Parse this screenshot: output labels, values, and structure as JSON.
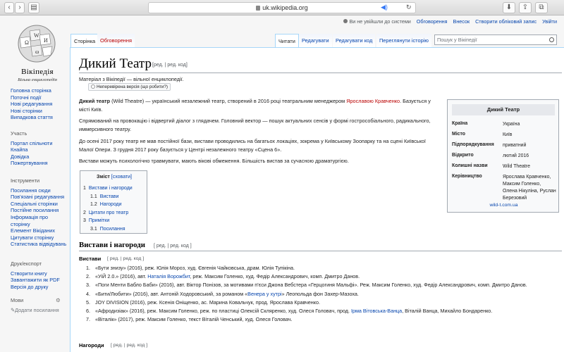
{
  "browser": {
    "url": "uk.wikipedia.org"
  },
  "logo": {
    "name": "Вікіпедія",
    "subtitle": "Вільна енциклопедія"
  },
  "header": {
    "not_logged": "Ви не увійшли до системи",
    "links": [
      "Обговорення",
      "Внесок",
      "Створити обліковий запис",
      "Увійти"
    ]
  },
  "sidebar": {
    "main": [
      "Головна сторінка",
      "Поточні події",
      "Нові редагування",
      "Нові сторінки",
      "Випадкова стаття"
    ],
    "participate_heading": "Участь",
    "participate": [
      "Портал спільноти",
      "Кнайпа",
      "Довідка",
      "Пожертвування"
    ],
    "tools_heading": "Інструменти",
    "tools": [
      "Посилання сюди",
      "Пов'язані редагування",
      "Спеціальні сторінки",
      "Постійне посилання",
      "Інформація про сторінку",
      "Елемент Вікіданих",
      "Цитувати сторінку",
      "Статистика відвідувань"
    ],
    "print_heading": "Друк/експорт",
    "print": [
      "Створити книгу",
      "Завантажити як PDF",
      "Версія до друку"
    ],
    "lang_heading": "Мови",
    "add_links": "Додати посилання"
  },
  "tabs": {
    "left": [
      "Сторінка",
      "Обговорення"
    ],
    "right": [
      "Читати",
      "Редагувати",
      "Редагувати код",
      "Переглянути історію"
    ],
    "search_placeholder": "Пошук у Вікіпедії"
  },
  "article": {
    "title": "Дикий Театр",
    "title_edit": "[ред. | ред. код]",
    "tagline": "Матеріал з Вікіпедії — вільної енциклопедії.",
    "unverified": "Неперевірена версія (що робити?)",
    "p1_bold": "Дикий театр",
    "p1_a": " (Wild Theatre) — український незалежний театр, створений в 2016 році театральним менеджером ",
    "p1_link": "Ярославою Кравченко",
    "p1_b": ". Базується у місті Київ.",
    "p2": "Спрямований на провокацію і відвертий діалог з глядачем. Головний вектор — пошук актуальних сенсів у формі гострособіального, радикального, иммерсивного театру.",
    "p3": "До осені 2017 року театр не мав постійної бази, вистави проводились на багатьох локаціях, зокрема у Київському Зоопарку та на сцені Київської Малої Опери. З грудня 2017 року базується у Центрі незалежного театру «Сцена 6».",
    "p4": "Вистави можуть психологічно травмувати, мають вікові обмеження. Більшість вистав за сучасною драматургією."
  },
  "infobox": {
    "title": "Дикий Театр",
    "rows": [
      {
        "k": "Країна",
        "v": "Україна"
      },
      {
        "k": "Місто",
        "v": "Київ"
      },
      {
        "k": "Підпорядкування",
        "v": "приватний"
      },
      {
        "k": "Відкрито",
        "v": "лютий 2016"
      },
      {
        "k": "Колишні назви",
        "v": "Wild Theatre"
      },
      {
        "k": "Керівництво",
        "v": "Ярослава Кравченко, Максим Голенко, Олена Нікуліна, Руслан Березовий"
      }
    ],
    "link": "wild-t.com.ua"
  },
  "toc": {
    "title": "Зміст",
    "toggle": "[сховати]",
    "items": [
      {
        "n": "1",
        "t": "Вистави і нагороди",
        "sub": false
      },
      {
        "n": "1.1",
        "t": "Вистави",
        "sub": true
      },
      {
        "n": "1.2",
        "t": "Нагороди",
        "sub": true
      },
      {
        "n": "2",
        "t": "Цитати про театр",
        "sub": false
      },
      {
        "n": "3",
        "t": "Примітки",
        "sub": false
      },
      {
        "n": "3.1",
        "t": "Посилання",
        "sub": true
      }
    ]
  },
  "section": {
    "h2": "Вистави і нагороди",
    "h2_edit": "[ ред. | ред. код ]",
    "h3_plays": "Вистави",
    "h3_edit": "[ ред. | ред. код ]",
    "h3_awards": "Нагороди",
    "h3_awards_edit": "[ ред. | ред. код ]",
    "plays": [
      {
        "n": "1.",
        "a": "«Бути знизу» (2016), реж. Юлія Мороз, худ. Євгенія Чайковська, драм. Юлія Тупікіна.",
        "link": "",
        "b": ""
      },
      {
        "n": "2.",
        "a": "«УіЙ 2.0.» (2016), авт. ",
        "link": "Наталія Ворожбит",
        "b": ", реж. Максим Голенко, худ. Федір Александрович, комп. Дмитро Данов."
      },
      {
        "n": "3.",
        "a": "«Поги Менти Бабло Баби» (2016), авт. Віктор Понізов, за мотивами п'єси Джона Вебстера «Герцогиня Мальфі». Реж. Максим Голенко, худ. Федір Александрович, комп. Дмитро Данов.",
        "link": "",
        "b": ""
      },
      {
        "n": "4.",
        "a": "«Бити/Любити» (2016), авт. Антоній Ходоровський, за романом «",
        "link": "Венера у хутрі",
        "b": "» Леопольда фон Захер-Мазоха."
      },
      {
        "n": "5.",
        "a": "JOY DIVISION (2016), реж. Ксенія Оніщенко, ас. Марина Ковальчук, прод. Ярослава Кравченко.",
        "link": "",
        "b": ""
      },
      {
        "n": "6.",
        "a": "«Афродизіак» (2016), реж. Максим Голенко, реж. по пластиці Олексій Скляренко, худ. Олеся Головач, прод. ",
        "link": "Ірма Вітовська-Ванца",
        "b": ", Віталій Ванца, Михайло Бондаренко."
      },
      {
        "n": "7.",
        "a": "«Віталік» (2017), реж. Максим Голенко, текст Віталій Ченський, худ. Олеся Головач.",
        "link": "",
        "b": ""
      }
    ]
  }
}
